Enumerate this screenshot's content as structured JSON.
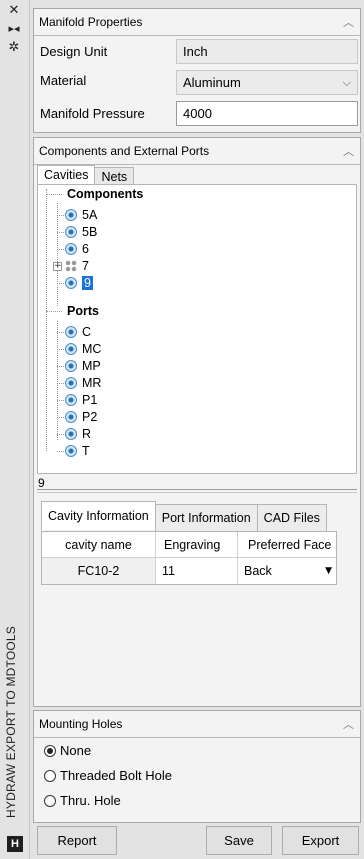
{
  "window": {
    "vertical_title": "HYDRAW EXPORT TO MDTOOLS",
    "logo_glyph": "H"
  },
  "manifold_properties": {
    "title": "Manifold Properties",
    "design_unit_label": "Design Unit",
    "design_unit_value": "Inch",
    "material_label": "Material",
    "material_value": "Aluminum",
    "pressure_label": "Manifold Pressure",
    "pressure_value": "4000"
  },
  "components_ports": {
    "title": "Components and External Ports",
    "tabs": [
      "Cavities",
      "Nets"
    ],
    "components_header": "Components",
    "components": [
      "5A",
      "5B",
      "6",
      "7",
      "9"
    ],
    "ports_header": "Ports",
    "ports": [
      "C",
      "MC",
      "MP",
      "MR",
      "P1",
      "P2",
      "R",
      "T"
    ],
    "selected_name": "9",
    "inner_tabs": [
      "Cavity Information",
      "Port Information",
      "CAD Files"
    ],
    "grid_headers": [
      "cavity name",
      "Engraving",
      "Preferred Face"
    ],
    "grid_row": {
      "cavity_name": "FC10-2",
      "engraving": "11",
      "preferred_face": "Back"
    }
  },
  "mounting_holes": {
    "title": "Mounting Holes",
    "options": [
      "None",
      "Threaded Bolt Hole",
      "Thru. Hole"
    ],
    "selected": "None"
  },
  "buttons": {
    "report": "Report",
    "save": "Save",
    "export": "Export"
  },
  "icons": {
    "close": "close-icon",
    "pin": "pin-icon",
    "settings": "gear-icon",
    "collapse": "chevron-up-icon",
    "component_node": "cavity-icon",
    "group_node": "group-icon"
  },
  "colors": {
    "selection": "#1a73d9"
  }
}
